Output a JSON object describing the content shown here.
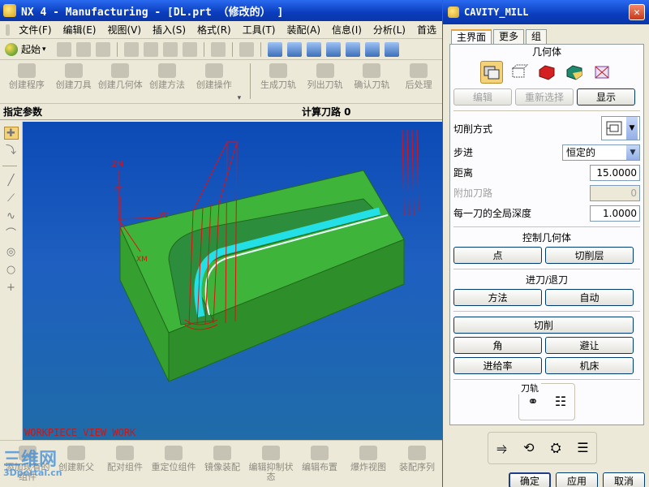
{
  "window": {
    "title": "NX 4 - Manufacturing - [DL.prt （修改的） ]"
  },
  "menu": [
    "文件(F)",
    "编辑(E)",
    "视图(V)",
    "插入(S)",
    "格式(R)",
    "工具(T)",
    "装配(A)",
    "信息(I)",
    "分析(L)",
    "首选"
  ],
  "toolbar1": {
    "start_label": "起始"
  },
  "toolbar2": [
    "创建程序",
    "创建刀具",
    "创建几何体",
    "创建方法",
    "创建操作",
    "生成刀轨",
    "列出刀轨",
    "确认刀轨",
    "后处理"
  ],
  "status": {
    "left": "指定参数",
    "right": "计算刀路 0"
  },
  "viewport": {
    "label": "WORKPIECE_VIEW WORK",
    "axis_labels": [
      "ZM",
      "ZC",
      "YC",
      "XM"
    ]
  },
  "bottom_toolbar": [
    "添加现有的组件",
    "创建新父",
    "配对组件",
    "重定位组件",
    "镜像装配",
    "编辑抑制状态",
    "编辑布置",
    "爆炸视图",
    "装配序列"
  ],
  "watermark": {
    "main": "三维网",
    "sub": "3Dportal.cn"
  },
  "dialog": {
    "title": "CAVITY_MILL",
    "tabs": [
      "主界面",
      "更多",
      "组"
    ],
    "geometry": {
      "section": "几何体",
      "icons": [
        "geometry-group-icon",
        "part-geometry-icon",
        "blank-geometry-icon",
        "check-geometry-icon",
        "trim-geometry-icon"
      ],
      "edit": "编辑",
      "reselect": "重新选择",
      "display": "显示"
    },
    "cut_method_label": "切削方式",
    "step_label": "步进",
    "step_value": "恒定的",
    "distance_label": "距离",
    "distance_value": "15.0000",
    "extra_paths_label": "附加刀路",
    "extra_paths_value": "0",
    "depth_label": "每一刀的全局深度",
    "depth_value": "1.0000",
    "control_geometry": {
      "section": "控制几何体",
      "point": "点",
      "cut_levels": "切削层"
    },
    "engage": {
      "section": "进刀/退刀",
      "method": "方法",
      "auto": "自动"
    },
    "cutting": "切削",
    "corner": "角",
    "avoidance": "避让",
    "feeds": "进给率",
    "machine": "机床",
    "toolpath_section": "刀轨",
    "buttons": {
      "ok": "确定",
      "apply": "应用",
      "cancel": "取消"
    }
  }
}
